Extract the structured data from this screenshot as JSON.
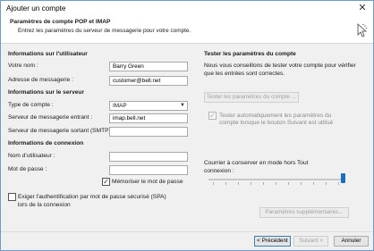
{
  "window": {
    "title": "Ajouter un compte",
    "close_glyph": "✕"
  },
  "header": {
    "title": "Paramètres de compte POP et IMAP",
    "subtitle": "Entrez les paramètres du serveur de messagerie pour votre compte."
  },
  "user_info": {
    "heading": "Informations sur l'utilisateur",
    "name_label": "Votre nom :",
    "name_value": "Barry Green",
    "email_label": "Adresse de messagerie :",
    "email_value": "customer@bell.net"
  },
  "server_info": {
    "heading": "Informations sur le serveur",
    "type_label": "Type de compte :",
    "type_value": "IMAP",
    "incoming_label": "Serveur de messagerie entrant :",
    "incoming_value": "imap.bell.net",
    "outgoing_label": "Serveur de messagerie sortant (SMTP) :",
    "outgoing_value": ""
  },
  "login_info": {
    "heading": "Informations de connexion",
    "username_label": "Nom d'utilisateur :",
    "username_value": "",
    "password_label": "Mot de passe :",
    "password_value": "",
    "remember_label": "Mémoriser le mot de passe",
    "remember_checked": true,
    "spa_label_line1": "Exiger l'authentification par mot de passe sécurisé (SPA)",
    "spa_label_line2": "lors de la connexion",
    "spa_checked": false
  },
  "test": {
    "heading": "Tester les paramètres du compte",
    "desc_line1": "Nous vous conseillons de tester votre compte pour vérifier",
    "desc_line2": "que les entrées sont correctes.",
    "test_button": "Tester les paramètres du compte ...",
    "auto_test_line1": "Tester automatiquement les paramètres du",
    "auto_test_line2": "compte lorsque le bouton Suivant est utilisé",
    "auto_test_checked": true
  },
  "offline": {
    "label_line1": "Courrier à conserver en mode hors",
    "label_line2": "connexion :",
    "value_text": "Tout",
    "slider_fraction": 1.0
  },
  "buttons": {
    "more_settings": "Paramètres supplémentaires...",
    "back": "< Précédent",
    "next": "Suivant >",
    "cancel": "Annuler"
  },
  "colors": {
    "accent": "#1a6fc4",
    "border": "#6f9bcc"
  },
  "icons": {
    "close": "close-icon",
    "header": "mouse-cursor-icon",
    "dropdown": "chevron-down-icon",
    "checkmark": "checkmark-icon"
  }
}
